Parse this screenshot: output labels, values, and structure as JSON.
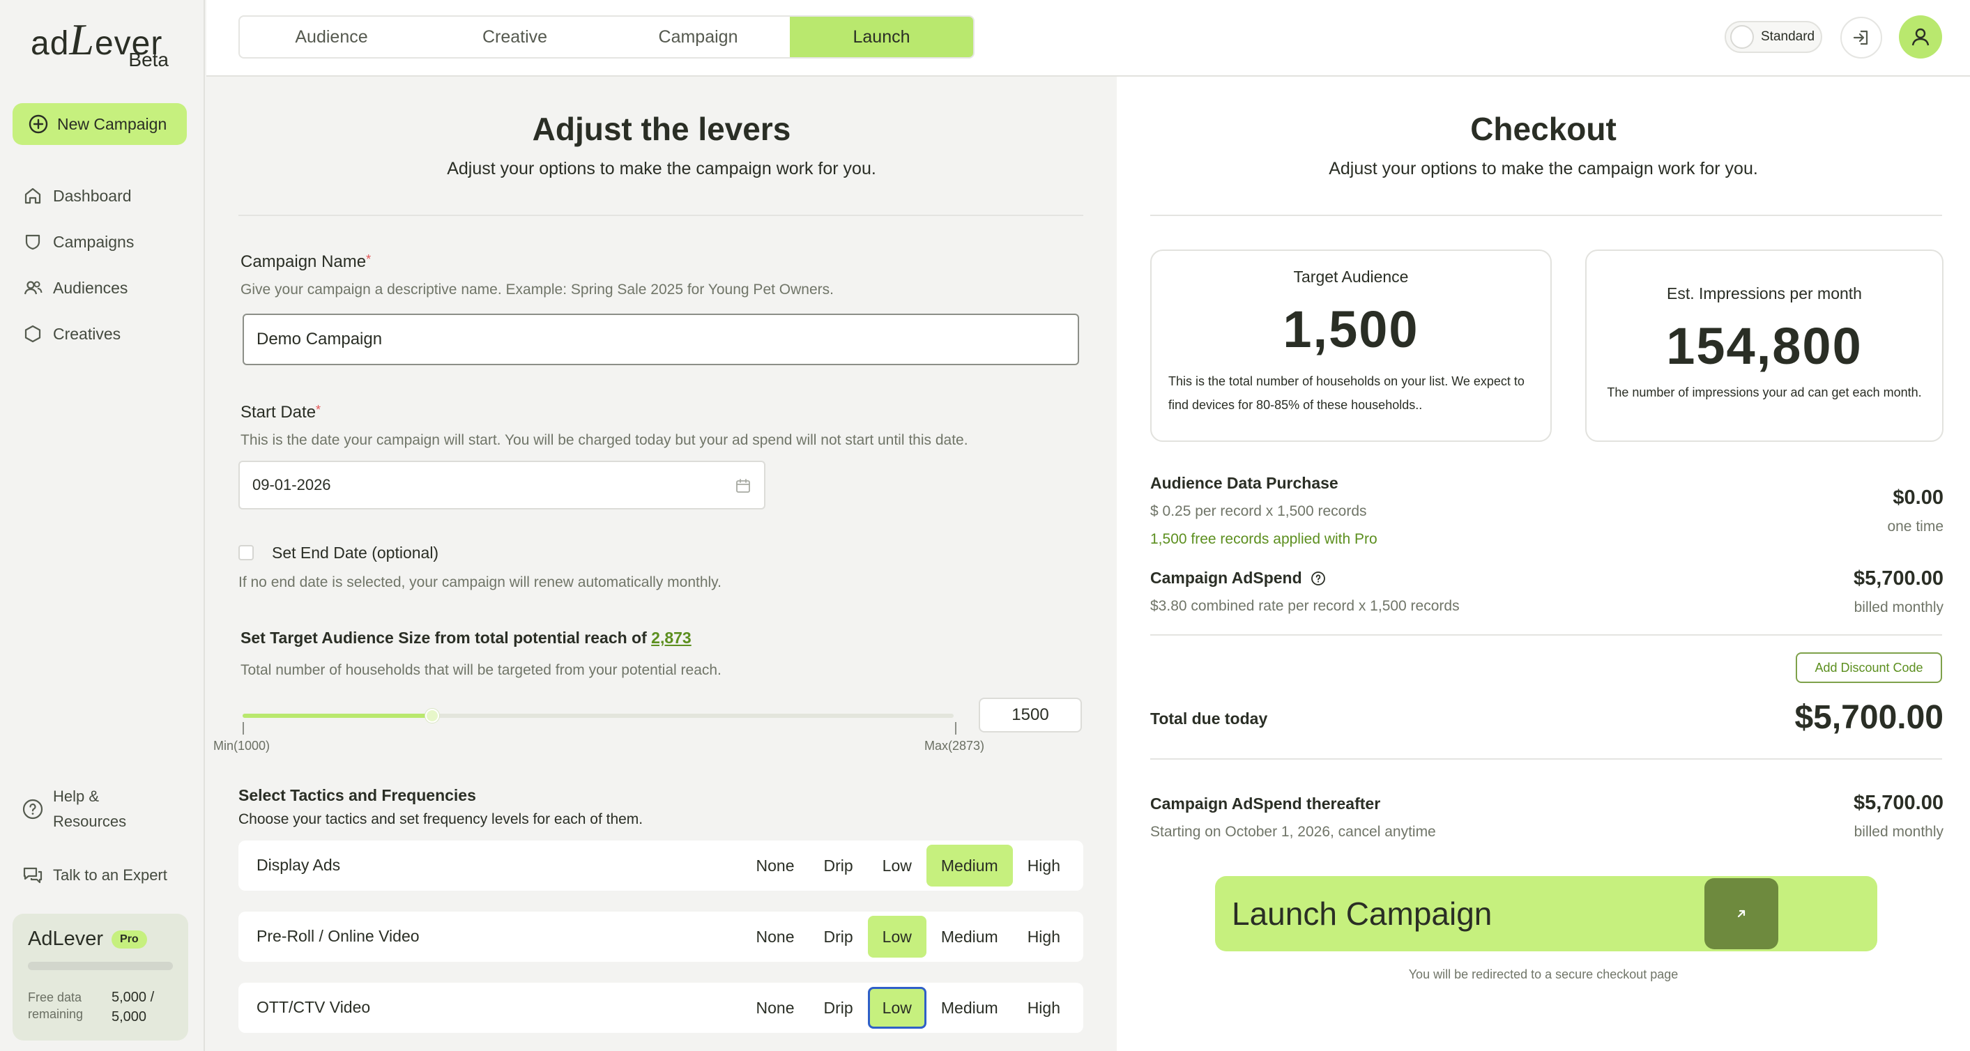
{
  "app": {
    "logo_main_a": "ad",
    "logo_main_b": "L",
    "logo_main_c": "ever",
    "logo_sub": "Beta"
  },
  "sidebar": {
    "new_campaign": "New Campaign",
    "items": [
      {
        "label": "Dashboard",
        "icon": "home-icon"
      },
      {
        "label": "Campaigns",
        "icon": "shield-icon"
      },
      {
        "label": "Audiences",
        "icon": "users-icon"
      },
      {
        "label": "Creatives",
        "icon": "hexagon-icon"
      }
    ],
    "help_line1": "Help &",
    "help_line2": "Resources",
    "talk": "Talk to an Expert",
    "plan": {
      "name": "AdLever",
      "badge": "Pro",
      "label_line1": "Free data",
      "label_line2": "remaining",
      "value_line1": "5,000 /",
      "value_line2": "5,000",
      "used_fraction": 0
    }
  },
  "topbar": {
    "tabs": [
      "Audience",
      "Creative",
      "Campaign",
      "Launch"
    ],
    "active_tab": "Launch",
    "mode_toggle": "Standard"
  },
  "levers": {
    "title": "Adjust the levers",
    "subtitle": "Adjust your options to make the campaign work for you.",
    "campaign_name_label": "Campaign Name",
    "campaign_name_help": "Give your campaign a descriptive name. Example: Spring Sale 2025 for Young Pet Owners.",
    "campaign_name_value": "Demo Campaign",
    "start_date_label": "Start Date",
    "start_date_help": "This is the date your campaign will start. You will be charged today but your ad spend will not start until this date.",
    "start_date_value": "09-01-2026",
    "end_date_label": "Set End Date (optional)",
    "end_date_help": "If no end date is selected, your campaign will renew automatically monthly.",
    "audience_size_label": "Set Target Audience Size from total potential reach of",
    "potential_reach": "2,873",
    "audience_size_help": "Total number of households that will be targeted from your potential reach.",
    "slider": {
      "min": 1000,
      "max": 2873,
      "value": 1500,
      "min_label": "Min(1000)",
      "max_label": "Max(2873)"
    },
    "audience_size_value": "1500",
    "tactics_label": "Select Tactics and Frequencies",
    "tactics_help": "Choose your tactics and set frequency levels for each of them.",
    "frequency_options": [
      "None",
      "Drip",
      "Low",
      "Medium",
      "High"
    ],
    "tactics": [
      {
        "name": "Display Ads",
        "selected": "Medium"
      },
      {
        "name": "Pre-Roll / Online Video",
        "selected": "Low"
      },
      {
        "name": "OTT/CTV Video",
        "selected": "Low"
      }
    ]
  },
  "checkout": {
    "title": "Checkout",
    "subtitle": "Adjust your options to make the campaign work for you.",
    "target_audience": {
      "label": "Target Audience",
      "value": "1,500",
      "note": "This is the total number of households on your list. We expect to find devices for 80-85% of these households.."
    },
    "impressions": {
      "label": "Est. Impressions per month",
      "value": "154,800",
      "note": "The number of impressions your ad can get each month."
    },
    "audience_purchase": {
      "label": "Audience Data Purchase",
      "rate": "$ 0.25 per record x 1,500 records",
      "free_note": "1,500 free records applied with Pro",
      "amount": "$0.00",
      "period": "one time"
    },
    "adspend": {
      "label": "Campaign AdSpend",
      "rate": "$3.80 combined rate per record x 1,500 records",
      "amount": "$5,700.00",
      "period": "billed monthly"
    },
    "discount_button": "Add Discount Code",
    "total_label": "Total due today",
    "total_amount": "$5,700.00",
    "thereafter": {
      "label": "Campaign AdSpend thereafter",
      "sub": "Starting on October 1, 2026, cancel anytime",
      "amount": "$5,700.00",
      "period": "billed monthly"
    },
    "launch_button": "Launch Campaign",
    "redirect_note": "You will be redirected to a secure checkout page"
  },
  "colors": {
    "accent": "#c6f07e",
    "accent_dark": "#6e8a3e",
    "link_green": "#5c8f1f",
    "focus_blue": "#2f5fc8"
  }
}
